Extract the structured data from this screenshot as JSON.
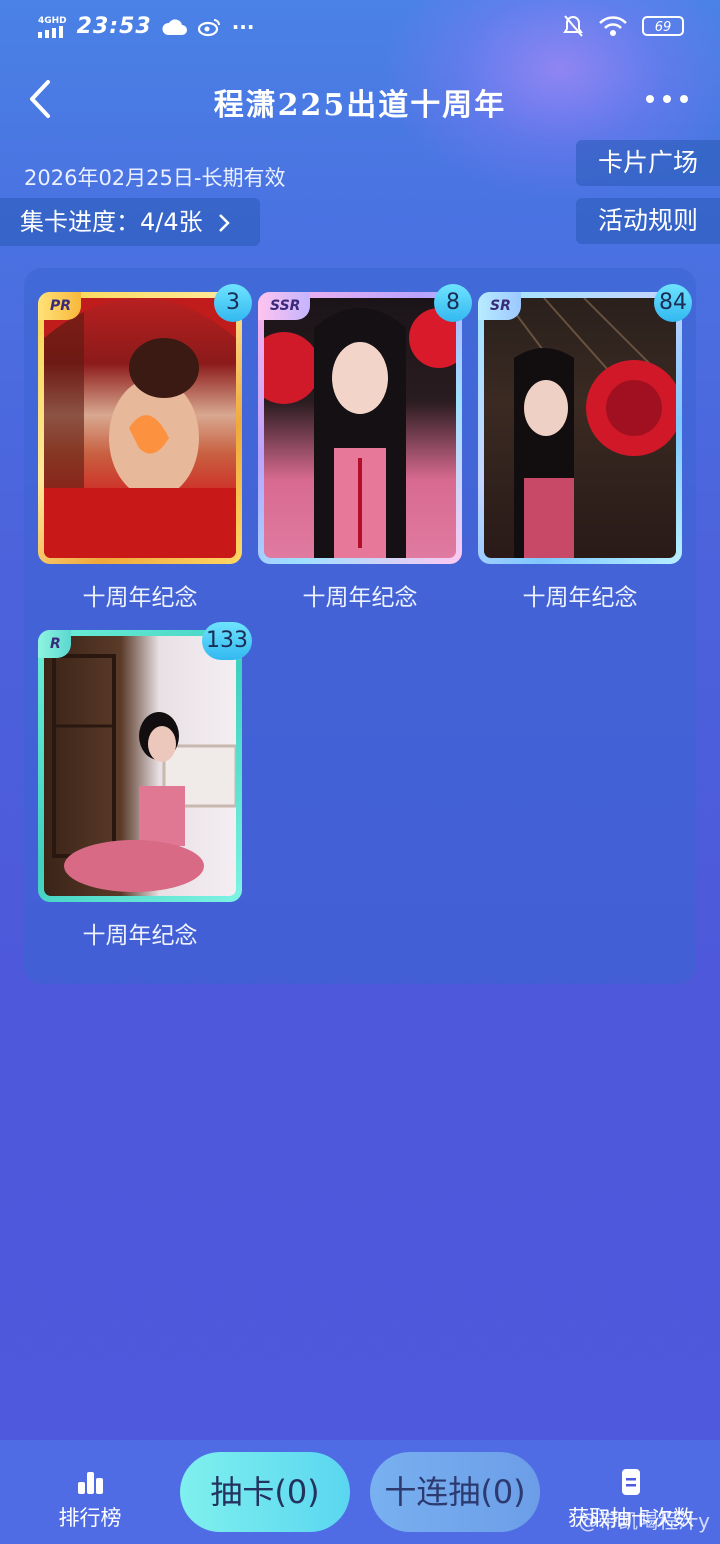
{
  "status_bar": {
    "network": "4GHD",
    "time": "23:53",
    "battery": "69"
  },
  "header": {
    "title": "程潇225出道十周年"
  },
  "event": {
    "validity": "2026年02月25日-长期有效",
    "progress_label": "集卡进度：4/4张",
    "card_square_label": "卡片广场",
    "rules_label": "活动规则"
  },
  "cards": [
    {
      "rarity": "PR",
      "count": "3",
      "name": "十周年纪念"
    },
    {
      "rarity": "SSR",
      "count": "8",
      "name": "十周年纪念"
    },
    {
      "rarity": "SR",
      "count": "84",
      "name": "十周年纪念"
    },
    {
      "rarity": "R",
      "count": "133",
      "name": "十周年纪念"
    }
  ],
  "bottom_bar": {
    "leaderboard_label": "排行榜",
    "draw_label": "抽卡(0)",
    "draw_ten_label": "十连抽(0)",
    "get_draws_label": "获取抽卡次数"
  },
  "watermark": "@带凯喝程汁y",
  "colors": {
    "accent_cyan": "#6fe3ff",
    "frame_pr": "#f5c84a",
    "frame_ssr": "#c9b4ff",
    "frame_sr": "#8fd8ff",
    "frame_r": "#3fe0c8"
  }
}
